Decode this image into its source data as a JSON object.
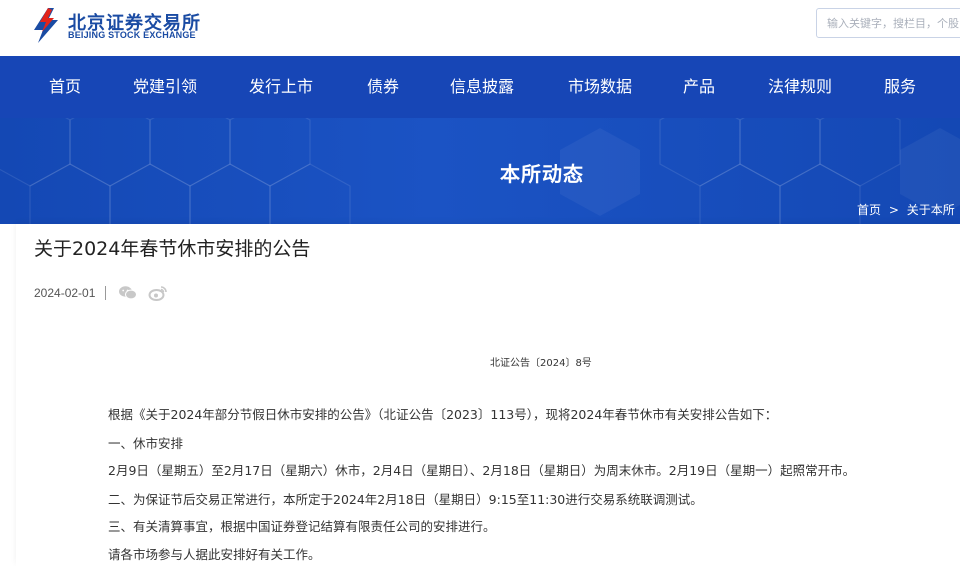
{
  "header": {
    "logo_cn": "北京证券交易所",
    "logo_en": "BEIJING STOCK EXCHANGE",
    "search_placeholder": "输入关键字，搜栏目，个股，"
  },
  "nav": {
    "items": [
      "首页",
      "党建引领",
      "发行上市",
      "债券",
      "信息披露",
      "市场数据",
      "产品",
      "法律规则",
      "服务"
    ]
  },
  "banner": {
    "title": "本所动态",
    "breadcrumb": [
      "首页",
      ">",
      "关于本所"
    ]
  },
  "article": {
    "title": "关于2024年春节休市安排的公告",
    "date": "2024-02-01",
    "share_icons": [
      "wechat-icon",
      "weibo-icon"
    ],
    "doc_number": "北证公告〔2024〕8号",
    "paragraphs": [
      "根据《关于2024年部分节假日休市安排的公告》（北证公告〔2023〕113号），现将2024年春节休市有关安排公告如下：",
      "一、休市安排",
      "2月9日（星期五）至2月17日（星期六）休市，2月4日（星期日）、2月18日（星期日）为周末休市。2月19日（星期一）起照常开市。",
      "二、为保证节后交易正常进行，本所定于2024年2月18日（星期日）9:15至11:30进行交易系统联调测试。",
      "三、有关清算事宜，根据中国证券登记结算有限责任公司的安排进行。",
      "请各市场参与人据此安排好有关工作。"
    ]
  },
  "colors": {
    "brand_blue": "#1746b6",
    "banner_blue": "#1b53c4",
    "logo_red": "#e2231a"
  }
}
